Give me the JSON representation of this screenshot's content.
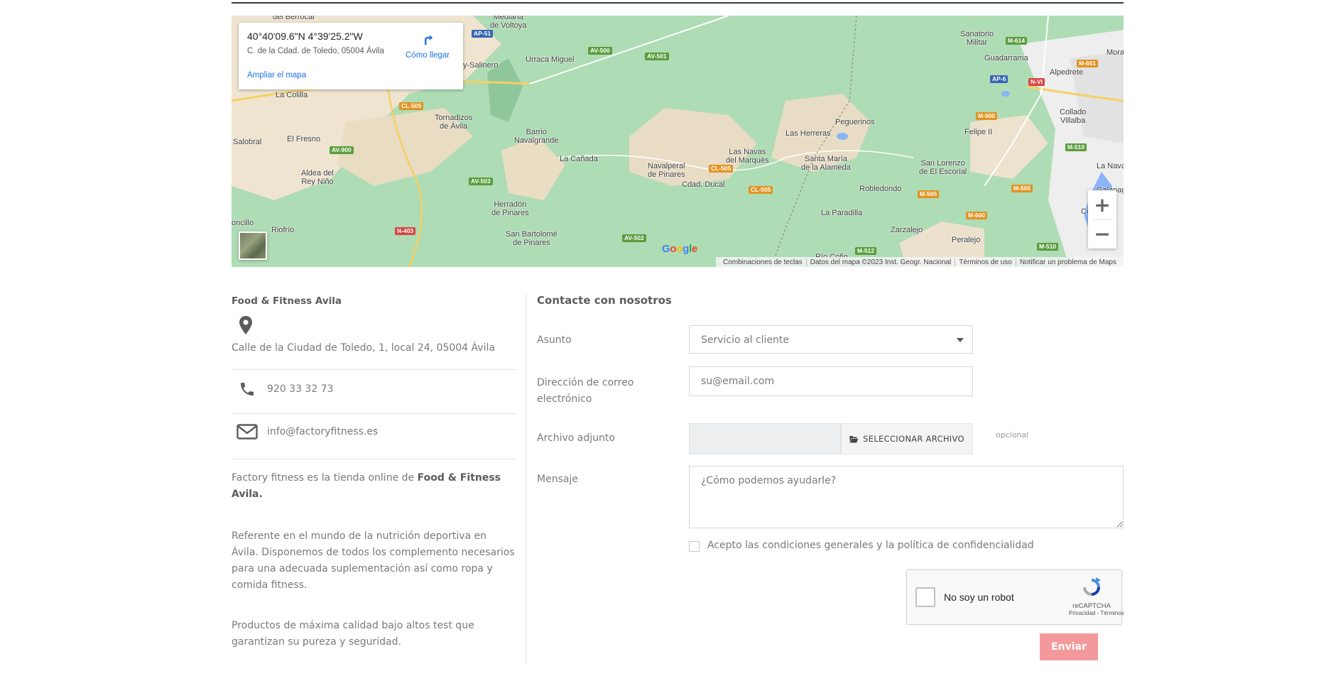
{
  "map": {
    "coordinates": "40°40'09.6\"N 4°39'25.2\"W",
    "address": "C. de la Cdad. de Toledo, 05004 Ávila",
    "directions_label": "Cómo llegar",
    "enlarge_label": "Ampliar el mapa",
    "zoom_in": "+",
    "zoom_out": "−",
    "google_logo": "Google",
    "attribution": {
      "shortcuts": "Combinaciones de teclas",
      "data": "Datos del mapa ©2023 Inst. Geogr. Nacional",
      "terms": "Términos de uso",
      "report": "Notificar un problema de Maps"
    },
    "places": {
      "berrocal": "del Berrocal",
      "voltoya": "Mediana\nde Voltoya",
      "salinero": "y-Salinero",
      "urraca": "Urraca Miguel",
      "colilla": "La Colilla",
      "tornadizos": "Tornadizos\nde Ávila",
      "barrio": "Barrio\nNavalgrande",
      "salobral": "Salobral",
      "fresno": "El Fresno",
      "canada": "La Cañada",
      "aldea": "Aldea del\nRey Niño",
      "navalperal": "Navalperal\nde Pinares",
      "ducal": "Cdad. Ducal",
      "navas": "Las Navas\ndel Marqués",
      "santamaria": "Santa María\nde la Alameda",
      "herreras": "Las Herreras",
      "peguerinos": "Peguerinos",
      "herradon": "Herradón\nde Pinares",
      "ronquillo": "oncillo",
      "riofrio": "Riofrío",
      "sanbartolome": "San Bartolomé\nde Pinares",
      "robledondo": "Robledondo",
      "paradilla": "La Paradilla",
      "zarzalejo": "Zarzalejo",
      "peralejo": "Peralejo",
      "riocofio": "Río Cofio",
      "sanlorenzo": "San Lorenzo\nde El Escorial",
      "felipe": "Felipe II",
      "sanatorio": "Sanatorio\nMilitar",
      "guadarrama": "Guadarrama",
      "alpedrete": "Alpedrete",
      "collado": "Collado\nVillalba",
      "lanava": "La Nava",
      "galapagar": "Galapagar",
      "colmenar": "Colmena",
      "mora": "Mora"
    },
    "roads": {
      "ap51": "AP-51",
      "av500": "AV-500",
      "av501": "AV-501",
      "cl505a": "CL-505",
      "av900": "AV-900",
      "av503": "AV-503",
      "cl505b": "CL-505",
      "cl505c": "CL-505",
      "n403": "N-403",
      "av502": "AV-502",
      "m614": "M-614",
      "m601": "M-601",
      "ap6": "AP-6",
      "nvi": "N-VI",
      "m600a": "M-600",
      "m510a": "M-510",
      "m505a": "M-505",
      "m505b": "M-505",
      "m600b": "M-600",
      "m512": "M-512",
      "m510b": "M-510"
    }
  },
  "store": {
    "name": "Food & Fitness Avila",
    "address": "Calle de la Ciudad de Toledo, 1, local 24, 05004 Ávila",
    "phone": "920 33 32 73",
    "email": "info@factoryfitness.es",
    "para1_prefix": "Factory fitness es la tienda online de",
    "para1_bold": "Food & Fitness Avila.",
    "para2": "Referente en el mundo de la nutrición deportiva en Ávila. Disponemos de todos los complemento necesarios para una adecuada suplementación así como ropa y comida fitness.",
    "para3": "Productos de máxima calidad bajo altos test que garantizan su pureza y seguridad."
  },
  "form": {
    "title": "Contacte con nosotros",
    "subject_label": "Asunto",
    "subject_value": "Servicio al cliente",
    "email_label": "Dirección de correo electrónico",
    "email_placeholder": "su@email.com",
    "attachment_label": "Archivo adjunto",
    "file_button": "SELECCIONAR ARCHIVO",
    "optional": "opcional",
    "message_label": "Mensaje",
    "message_placeholder": "¿Cómo podemos ayudarle?",
    "consent": "Acepto las condiciones generales y la política de confidencialidad",
    "captcha_text": "No soy un robot",
    "captcha_brand": "reCAPTCHA",
    "captcha_links": "Privacidad - Términos",
    "submit": "Enviar"
  },
  "colors": {
    "submit_bg": "#f3999b",
    "link_blue": "#1a73e8",
    "map_green": "#aedcb4"
  }
}
